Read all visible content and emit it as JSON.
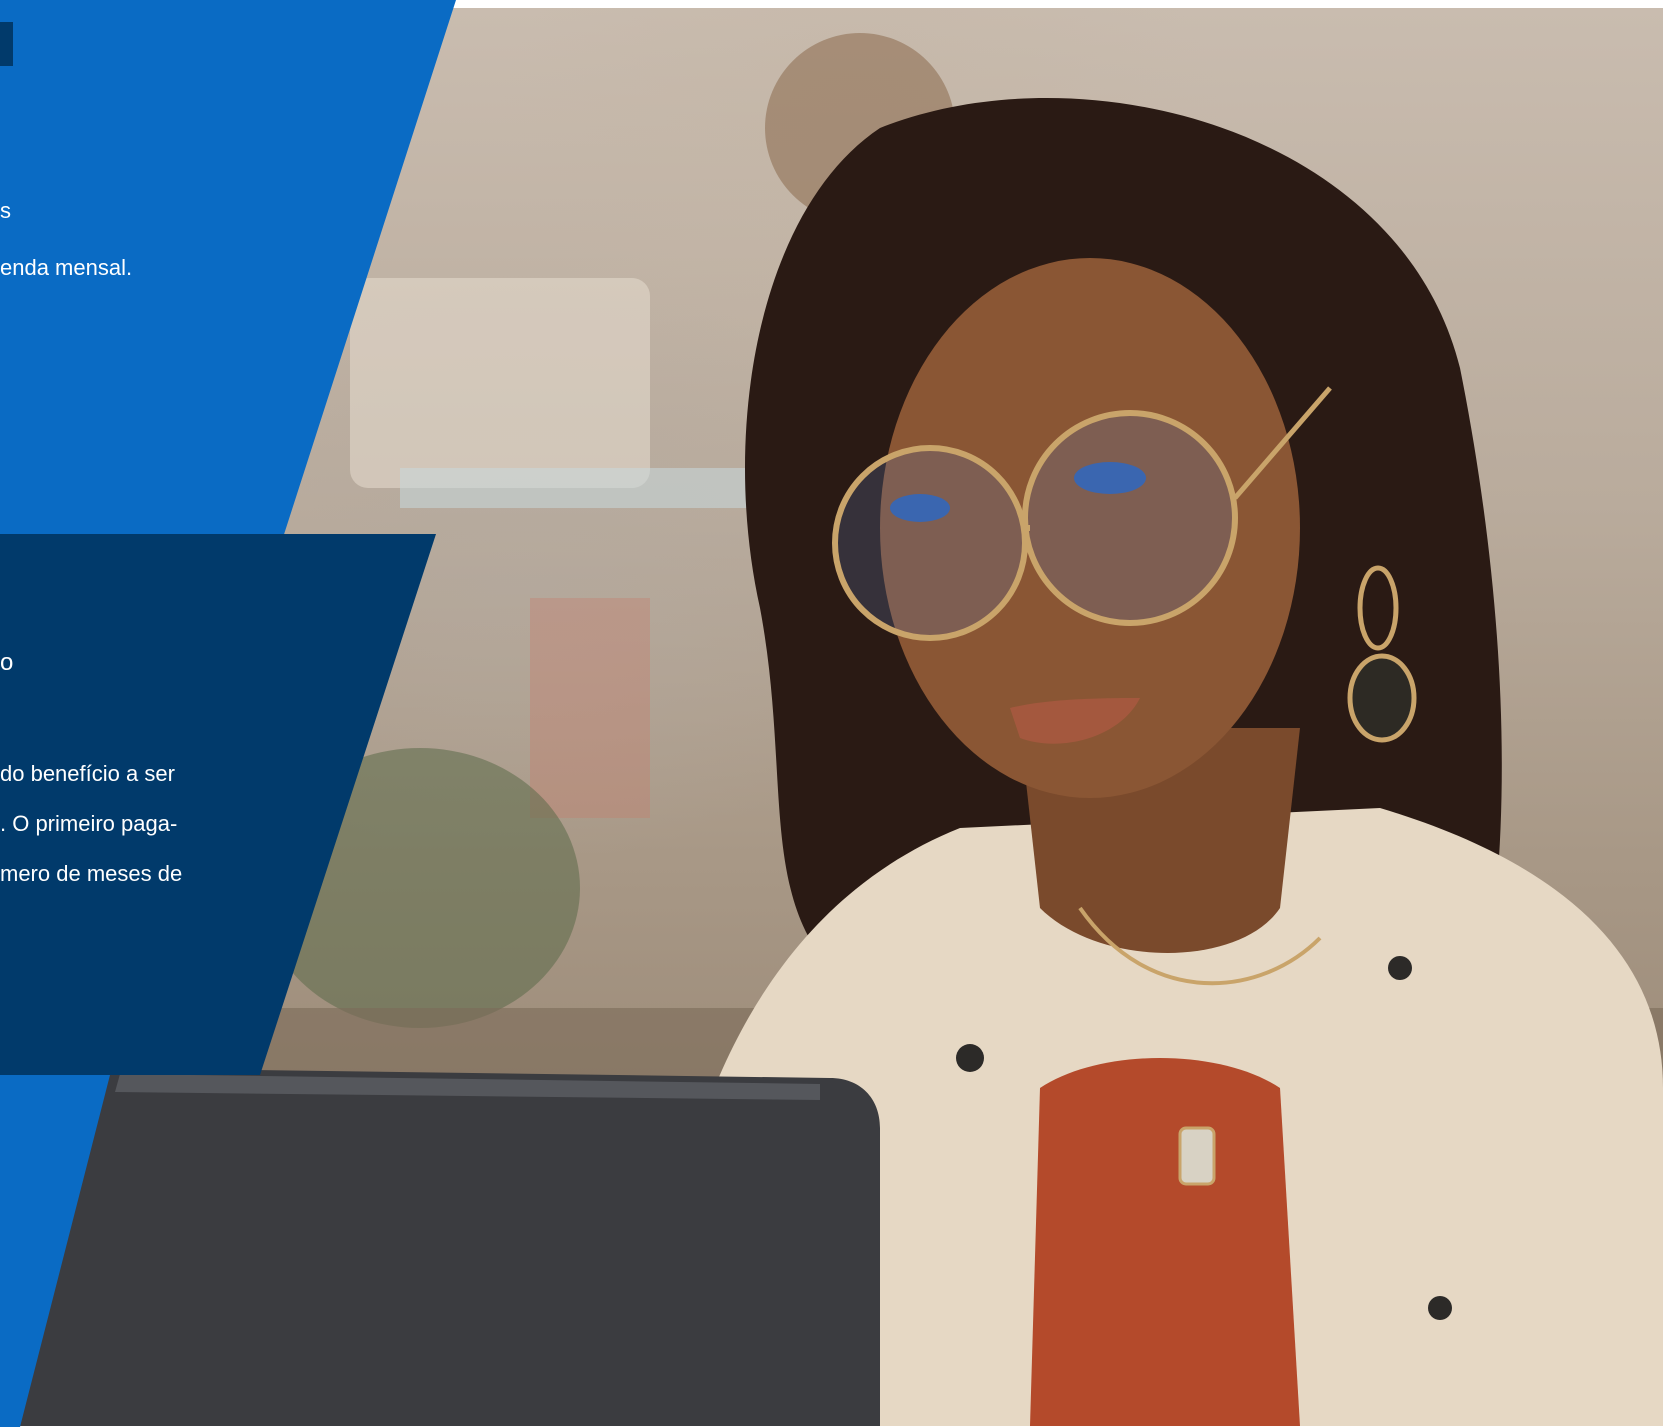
{
  "upper_panel": {
    "line_1": "s",
    "line_2": "enda mensal."
  },
  "lower_panel": {
    "line_heading": "o",
    "line_1": "do benefício a ser",
    "line_2": ". O primeiro paga-",
    "line_3": "mero de meses de"
  },
  "colors": {
    "light_blue": "#0a6bc4",
    "dark_blue": "#013a6b",
    "text": "#ffffff"
  },
  "photo": {
    "subject": "woman-with-glasses-using-laptop"
  }
}
